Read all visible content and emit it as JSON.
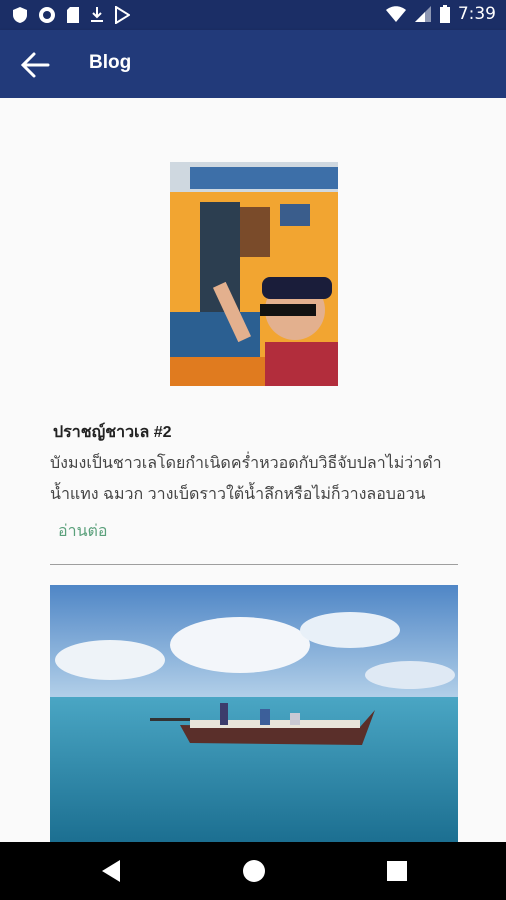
{
  "status_bar": {
    "time": "7:39",
    "icons": [
      "shield-icon",
      "record-icon",
      "sd-card-icon",
      "download-icon",
      "play-store-icon",
      "wifi-icon",
      "signal-icon",
      "battery-icon"
    ]
  },
  "app_bar": {
    "title": "Blog",
    "back_icon": "arrow-back-icon"
  },
  "posts": [
    {
      "title": "ปราชญ์ชาวเล #2",
      "excerpt": "บังมงเป็นชาวเลโดยกำเนิดคร่ำหวอดกับวิธีจับปลาไม่ว่าดำน้ำแทง ฉมวก วางเบ็ดราวใต้น้ำลึกหรือไม่ก็วางลอบอวน",
      "read_more": "อ่านต่อ"
    }
  ],
  "nav_bar": {
    "buttons": [
      "back-triangle-icon",
      "home-circle-icon",
      "recents-square-icon"
    ]
  },
  "colors": {
    "status_bar": "#1b2e66",
    "app_bar": "#223a7a",
    "accent_green": "#5aa07b"
  }
}
